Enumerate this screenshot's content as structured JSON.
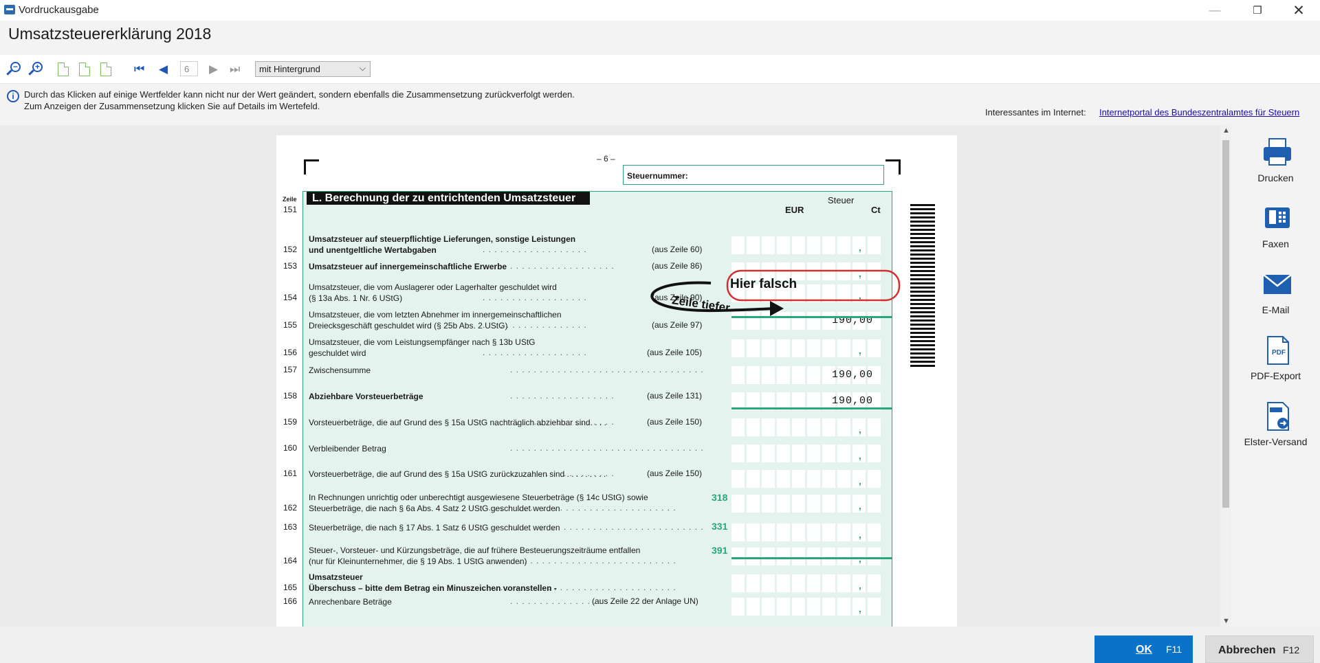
{
  "window": {
    "title": "Vordruckausgabe",
    "min": "—",
    "max": "❐",
    "close": "✕"
  },
  "header": {
    "title": "Umsatzsteuererklärung 2018"
  },
  "toolbar": {
    "page_number": "6",
    "background_option": "mit Hintergrund",
    "icons": [
      "zoom-out-icon",
      "zoom-in-icon",
      "page-icon",
      "page-width-icon",
      "full-page-icon",
      "first-page-icon",
      "previous-page-icon",
      "next-page-icon",
      "last-page-icon"
    ]
  },
  "infobar": {
    "line1": "Durch das Klicken auf einige Wertfelder kann nicht nur der Wert geändert, sondern ebenfalls die Zusammensetzung zurückverfolgt werden.",
    "line2": "Zum Anzeigen der Zusammensetzung klicken Sie auf Details im Wertefeld.",
    "internet_label": "Interessantes im Internet:",
    "internet_link": "Internetportal des Bundeszentralamtes für Steuern"
  },
  "form": {
    "page_marker": "– 6 –",
    "steuernummer_label": "Steuernummer:",
    "zeile_label": "Zeile",
    "section_title": "L. Berechnung der zu entrichtenden Umsatzsteuer",
    "col_steuer": "Steuer",
    "col_eur": "EUR",
    "col_ct": "Ct",
    "rows": [
      {
        "num": "151",
        "lines": [],
        "ref": "",
        "kz": "",
        "value": ""
      },
      {
        "num": "152",
        "lines": [
          "Umsatzsteuer auf steuerpflichtige Lieferungen, sonstige Leistungen",
          "und unentgeltliche Wertabgaben"
        ],
        "ref": "(aus Zeile 60)",
        "kz": "",
        "value": ""
      },
      {
        "num": "153",
        "lines": [
          "Umsatzsteuer auf innergemeinschaftliche Erwerbe"
        ],
        "ref": "(aus Zeile 86)",
        "kz": "",
        "value": ""
      },
      {
        "num": "154",
        "lines": [
          "Umsatzsteuer, die vom Auslagerer oder Lagerhalter geschuldet wird",
          "(§ 13a Abs. 1 Nr. 6 UStG)"
        ],
        "ref": "(aus Zeile 90)",
        "kz": "",
        "value": ""
      },
      {
        "num": "155",
        "lines": [
          "Umsatzsteuer, die vom letzten Abnehmer im innergemeinschaftlichen",
          "Dreiecksgeschäft geschuldet wird (§ 25b Abs. 2 UStG)"
        ],
        "ref": "(aus Zeile 97)",
        "kz": "",
        "value": "190,00"
      },
      {
        "num": "156",
        "lines": [
          "Umsatzsteuer, die vom Leistungsempfänger nach § 13b UStG",
          "geschuldet wird"
        ],
        "ref": "(aus Zeile 105)",
        "kz": "",
        "value": ""
      },
      {
        "num": "157",
        "lines": [
          "Zwischensumme"
        ],
        "ref": "",
        "kz": "",
        "value": "190,00"
      },
      {
        "num": "158",
        "lines": [
          "Abziehbare Vorsteuerbeträge"
        ],
        "ref": "(aus Zeile 131)",
        "kz": "",
        "value": "190,00"
      },
      {
        "num": "159",
        "lines": [
          "Vorsteuerbeträge, die auf Grund des § 15a UStG nachträglich abziehbar sind. . . ."
        ],
        "ref": "(aus Zeile 150)",
        "kz": "",
        "value": ""
      },
      {
        "num": "160",
        "lines": [
          "Verbleibender Betrag"
        ],
        "ref": "",
        "kz": "",
        "value": ""
      },
      {
        "num": "161",
        "lines": [
          "Vorsteuerbeträge, die auf Grund des § 15a UStG zurückzuzahlen sind . . . . . . . . ."
        ],
        "ref": "(aus Zeile 150)",
        "kz": "",
        "value": ""
      },
      {
        "num": "162",
        "lines": [
          "In Rechnungen unrichtig oder unberechtigt ausgewiesene Steuerbeträge (§ 14c UStG) sowie",
          "Steuerbeträge, die nach § 6a Abs. 4 Satz 2 UStG geschuldet werden"
        ],
        "ref": "",
        "kz": "318",
        "value": ""
      },
      {
        "num": "163",
        "lines": [
          "Steuerbeträge, die nach § 17 Abs. 1 Satz 6 UStG geschuldet werden"
        ],
        "ref": "",
        "kz": "331",
        "value": ""
      },
      {
        "num": "164",
        "lines": [
          "Steuer-, Vorsteuer- und Kürzungsbeträge, die auf frühere Besteuerungszeiträume entfallen",
          "(nur für Kleinunternehmer, die § 19 Abs. 1 UStG anwenden)"
        ],
        "ref": "",
        "kz": "391",
        "value": ""
      },
      {
        "num": "165",
        "lines": [
          "Umsatzsteuer",
          "Überschuss – bitte dem Betrag ein Minuszeichen voranstellen -"
        ],
        "ref": "",
        "kz": "",
        "value": ""
      },
      {
        "num": "166",
        "lines": [
          "Anrechenbare Beträge"
        ],
        "ref": "(aus Zeile 22 der Anlage UN)",
        "kz": "",
        "value": ""
      }
    ]
  },
  "annotation": {
    "label": "Hier falsch",
    "arrow_label": "Zeile tiefer"
  },
  "actions": [
    {
      "label": "Drucken",
      "icon": "printer-icon"
    },
    {
      "label": "Faxen",
      "icon": "fax-icon"
    },
    {
      "label": "E-Mail",
      "icon": "mail-icon"
    },
    {
      "label": "PDF-Export",
      "icon": "pdf-icon"
    },
    {
      "label": "Elster-Versand",
      "icon": "elster-icon"
    }
  ],
  "footer": {
    "ok_label": "OK",
    "ok_key": "F11",
    "cancel_label": "Abbrechen",
    "cancel_key": "F12"
  },
  "colors": {
    "accent_blue": "#0a72c8",
    "form_green": "#2aa77a",
    "annotation_red": "#d23030"
  }
}
